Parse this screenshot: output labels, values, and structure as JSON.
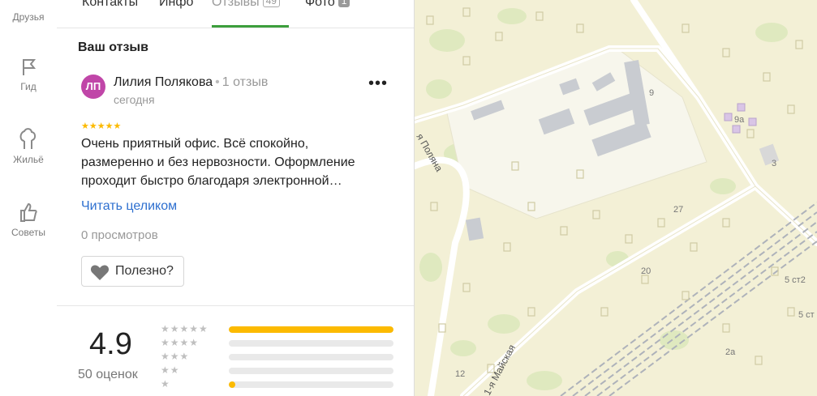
{
  "rail": {
    "items": [
      {
        "label": "Друзья",
        "icon": "friends-icon"
      },
      {
        "label": "Гид",
        "icon": "flag-icon"
      },
      {
        "label": "Жильё",
        "icon": "trees-icon"
      },
      {
        "label": "Советы",
        "icon": "thumbs-up-icon"
      }
    ]
  },
  "tabs": {
    "contacts": "Контакты",
    "info": "Инфо",
    "reviews": "Отзывы",
    "reviews_count": "49",
    "photos": "Фото",
    "photos_count": "1"
  },
  "review": {
    "section_title": "Ваш отзыв",
    "avatar_initials": "ЛП",
    "avatar_color": "#c046a8",
    "author": "Лилия Полякова",
    "author_meta": "1 отзыв",
    "date": "сегодня",
    "stars": "★★★★★",
    "rating": 5,
    "text_lines": [
      "Очень приятный офис. Всё спокойно,",
      "размеренно и без нервозности. Оформление",
      "проходит быстро благодаря электронной…"
    ],
    "read_more": "Читать целиком",
    "views": "0 просмотров",
    "useful": "Полезно?"
  },
  "summary": {
    "score": "4.9",
    "count": "50 оценок",
    "distribution": [
      {
        "stars": "★★★★★",
        "fraction": 1.0
      },
      {
        "stars": "★★★★",
        "fraction": 0.0
      },
      {
        "stars": "★★★",
        "fraction": 0.0
      },
      {
        "stars": "★★",
        "fraction": 0.0
      },
      {
        "stars": "★",
        "fraction": 0.04
      }
    ]
  },
  "map": {
    "street_1": "я Поляна",
    "street_2": "1-я Майская",
    "house_numbers": [
      "9",
      "9а",
      "3",
      "27",
      "20",
      "5 ст2",
      "5 ст",
      "2а",
      "12"
    ]
  },
  "colors": {
    "accent_green": "#3c9e3c",
    "star_yellow": "#fcba00",
    "link_blue": "#2d6fcf"
  }
}
